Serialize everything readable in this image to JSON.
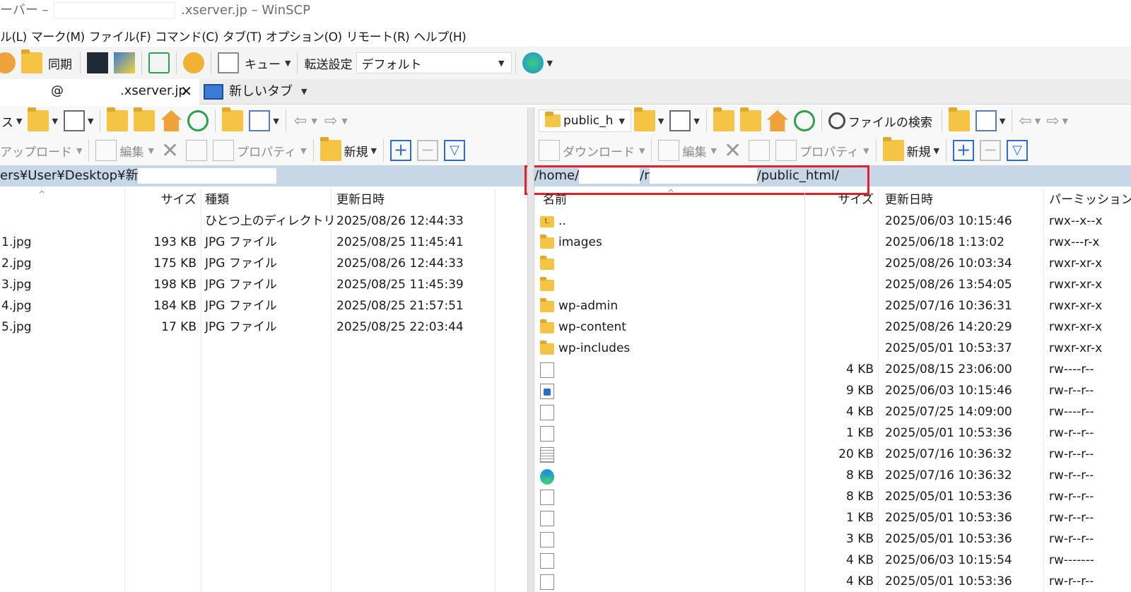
{
  "window": {
    "title_prefix": "ーバー –",
    "title_suffix": ".xserver.jp – WinSCP"
  },
  "menu": [
    "ル(L)",
    "マーク(M)",
    "ファイル(F)",
    "コマンド(C)",
    "タブ(T)",
    "オプション(O)",
    "リモート(R)",
    "ヘルプ(H)"
  ],
  "toolbar": {
    "sync_label": "同期",
    "queue_label": "キュー",
    "transfer_label": "転送設定",
    "transfer_value": "デフォルト"
  },
  "tabs": {
    "active_at": "@",
    "active_host": ".xserver.jp",
    "close": "✕",
    "new_tab": "新しいタブ"
  },
  "local": {
    "drive_label": "ス",
    "upload_label": "アップロード",
    "edit_label": "編集",
    "props_label": "プロパティ",
    "new_label": "新規",
    "path": "ers¥User¥Desktop¥新",
    "headers": {
      "size": "サイズ",
      "type": "種類",
      "modified": "更新日時"
    },
    "rows": [
      {
        "name": "",
        "size": "",
        "type": "ひとつ上のディレクトリ",
        "modified": "2025/08/26 12:44:33"
      },
      {
        "name": "1.jpg",
        "size": "193 KB",
        "type": "JPG ファイル",
        "modified": "2025/08/25 11:45:41"
      },
      {
        "name": "2.jpg",
        "size": "175 KB",
        "type": "JPG ファイル",
        "modified": "2025/08/26 12:44:33"
      },
      {
        "name": "3.jpg",
        "size": "198 KB",
        "type": "JPG ファイル",
        "modified": "2025/08/25 11:45:39"
      },
      {
        "name": "4.jpg",
        "size": "184 KB",
        "type": "JPG ファイル",
        "modified": "2025/08/25 21:57:51"
      },
      {
        "name": "5.jpg",
        "size": "17 KB",
        "type": "JPG ファイル",
        "modified": "2025/08/25 22:03:44"
      }
    ]
  },
  "remote": {
    "folder_label": "public_h",
    "search_label": "ファイルの検索",
    "download_label": "ダウンロード",
    "edit_label": "編集",
    "props_label": "プロパティ",
    "new_label": "新規",
    "path_part1": "/home/",
    "path_part2": "/r",
    "path_part3": "/public_html/",
    "headers": {
      "name": "名前",
      "size": "サイズ",
      "modified": "更新日時",
      "perm": "パーミッション"
    },
    "rows": [
      {
        "icon": "up",
        "name": "..",
        "size": "",
        "modified": "2025/06/03 10:15:46",
        "perm": "rwx--x--x"
      },
      {
        "icon": "folder",
        "name": "images",
        "size": "",
        "modified": "2025/06/18 1:13:02",
        "perm": "rwx---r-x"
      },
      {
        "icon": "folder",
        "name": "",
        "size": "",
        "modified": "2025/08/26 10:03:34",
        "perm": "rwxr-xr-x"
      },
      {
        "icon": "folder",
        "name": "",
        "size": "",
        "modified": "2025/08/26 13:54:05",
        "perm": "rwxr-xr-x"
      },
      {
        "icon": "folder",
        "name": "wp-admin",
        "size": "",
        "modified": "2025/07/16 10:36:31",
        "perm": "rwxr-xr-x"
      },
      {
        "icon": "folder",
        "name": "wp-content",
        "size": "",
        "modified": "2025/08/26 14:20:29",
        "perm": "rwxr-xr-x"
      },
      {
        "icon": "folder",
        "name": "wp-includes",
        "size": "",
        "modified": "2025/05/01 10:53:37",
        "perm": "rwxr-xr-x"
      },
      {
        "icon": "file",
        "name": "",
        "size": "4 KB",
        "modified": "2025/08/15 23:06:00",
        "perm": "rw----r--"
      },
      {
        "icon": "img",
        "name": "",
        "size": "9 KB",
        "modified": "2025/06/03 10:15:46",
        "perm": "rw-r--r--"
      },
      {
        "icon": "file",
        "name": "",
        "size": "4 KB",
        "modified": "2025/07/25 14:09:00",
        "perm": "rw----r--"
      },
      {
        "icon": "file",
        "name": "",
        "size": "1 KB",
        "modified": "2025/05/01 10:53:36",
        "perm": "rw-r--r--"
      },
      {
        "icon": "text",
        "name": "",
        "size": "20 KB",
        "modified": "2025/07/16 10:36:32",
        "perm": "rw-r--r--"
      },
      {
        "icon": "edge",
        "name": "",
        "size": "8 KB",
        "modified": "2025/07/16 10:36:32",
        "perm": "rw-r--r--"
      },
      {
        "icon": "file",
        "name": "",
        "size": "8 KB",
        "modified": "2025/05/01 10:53:36",
        "perm": "rw-r--r--"
      },
      {
        "icon": "file",
        "name": "",
        "size": "1 KB",
        "modified": "2025/05/01 10:53:36",
        "perm": "rw-r--r--"
      },
      {
        "icon": "file",
        "name": "",
        "size": "3 KB",
        "modified": "2025/05/01 10:53:36",
        "perm": "rw-r--r--"
      },
      {
        "icon": "file",
        "name": "",
        "size": "4 KB",
        "modified": "2025/06/03 10:15:54",
        "perm": "rw-------"
      },
      {
        "icon": "file",
        "name": "",
        "size": "4 KB",
        "modified": "2025/05/01 10:53:36",
        "perm": "rw-r--r--"
      }
    ]
  },
  "colors": {
    "path_bg": "#c8d7e8",
    "highlight": "#e0202a",
    "folder": "#f6c445"
  }
}
